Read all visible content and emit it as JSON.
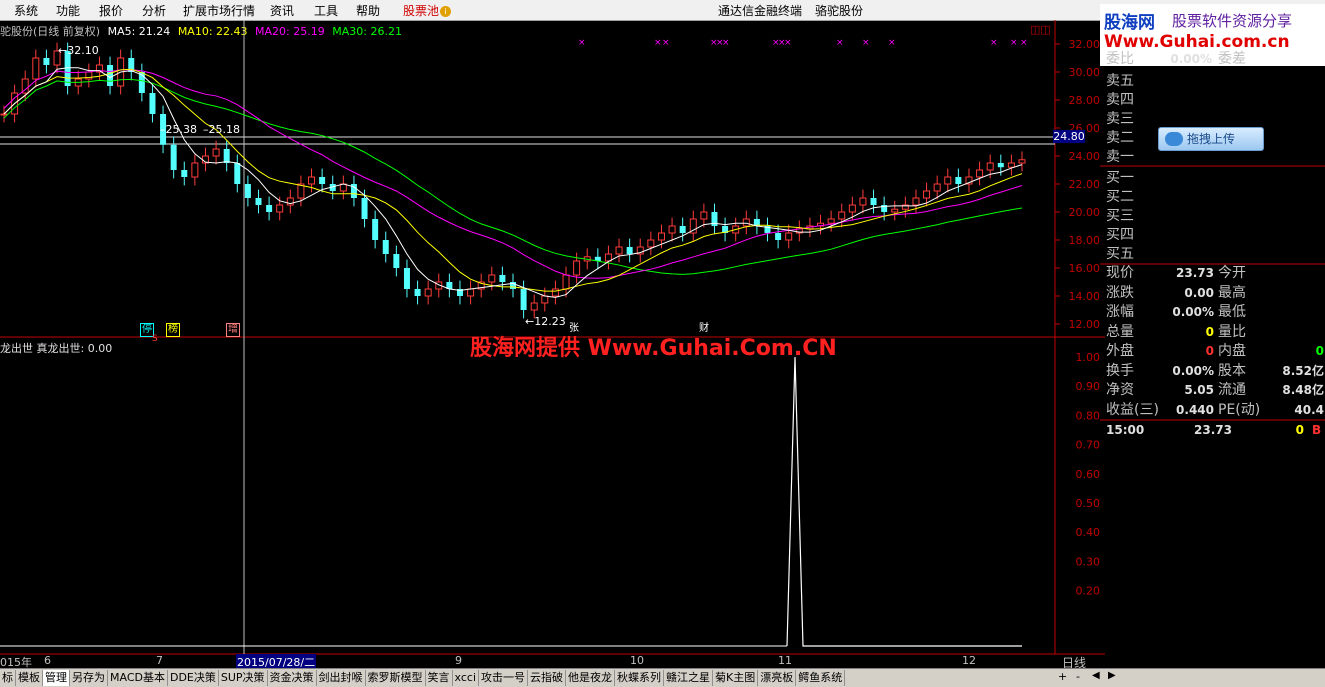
{
  "menu": {
    "items": [
      "系统",
      "功能",
      "报价",
      "分析",
      "扩展市场行情",
      "资讯",
      "工具",
      "帮助"
    ],
    "pool": "股票池",
    "center_title": "通达信金融终端",
    "stock_title": "骆驼股份"
  },
  "logo": {
    "line1": "股海网",
    "line1b": "股票软件资源分享",
    "line2": "Www.Guhai.com.cn"
  },
  "legend": {
    "title": "驼股份(日线 前复权)",
    "ma5": "MA5: 21.24",
    "ma10": "MA10: 22.43",
    "ma20": "MA20: 25.19",
    "ma30": "MA30: 26.21",
    "colors": {
      "ma5": "#ffffff",
      "ma10": "#ffff00",
      "ma20": "#ff00ff",
      "ma30": "#00ff00"
    }
  },
  "indicator_legend": "龙出世 真龙出世: 0.00",
  "watermark": "股海网提供 Www.Guhai.Com.CN",
  "price_tag": "24.80",
  "annotations": {
    "high": "32.10",
    "mid_left": "25.38",
    "mid_right": "25.18",
    "low": "12.23"
  },
  "markers": {
    "ting": "停",
    "bang": "榜",
    "zeng": "增",
    "zhang": "张",
    "cai": "财",
    "s": "S"
  },
  "price_axis": [
    "32.00",
    "30.00",
    "28.00",
    "26.00",
    "24.00",
    "22.00",
    "20.00",
    "18.00",
    "16.00",
    "14.00",
    "12.00"
  ],
  "ind_axis": [
    "1.00",
    "0.90",
    "0.80",
    "0.70",
    "0.60",
    "0.50",
    "0.40",
    "0.30",
    "0.20"
  ],
  "date_axis": {
    "labels": [
      "015年",
      "6",
      "7",
      "9",
      "10",
      "11",
      "12"
    ],
    "selected": "2015/07/28/二"
  },
  "period": "日线",
  "upload_button": "拖拽上传",
  "quote": {
    "asks": [
      "卖五",
      "卖四",
      "卖三",
      "卖二",
      "卖一"
    ],
    "bids": [
      "买一",
      "买二",
      "买三",
      "买四",
      "买五"
    ],
    "top_partial": {
      "label": "委比",
      "value": "0.00%",
      "label2": "委差"
    },
    "rows": [
      {
        "l1": "现价",
        "v1": "23.73",
        "l2": "今开",
        "v2": ""
      },
      {
        "l1": "涨跌",
        "v1": "0.00",
        "l2": "最高",
        "v2": ""
      },
      {
        "l1": "涨幅",
        "v1": "0.00%",
        "l2": "最低",
        "v2": ""
      },
      {
        "l1": "总量",
        "v1": "0",
        "l2": "量比",
        "v2": ""
      },
      {
        "l1": "外盘",
        "v1": "0",
        "l2": "内盘",
        "v2": "0"
      },
      {
        "l1": "换手",
        "v1": "0.00%",
        "l2": "股本",
        "v2": "8.52亿"
      },
      {
        "l1": "净资",
        "v1": "5.05",
        "l2": "流通",
        "v2": "8.48亿"
      },
      {
        "l1": "收益(三)",
        "v1": "0.440",
        "l2": "PE(动)",
        "v2": "40.4"
      }
    ],
    "tick": {
      "time": "15:00",
      "price": "23.73",
      "vol": "0",
      "side": "B"
    }
  },
  "tabs": [
    {
      "label": "标",
      "active": false
    },
    {
      "label": "模板",
      "active": false
    },
    {
      "label": "管理",
      "active": true
    },
    {
      "label": "另存为",
      "active": false
    },
    {
      "label": "MACD基本",
      "active": false
    },
    {
      "label": "DDE决策",
      "active": false
    },
    {
      "label": "SUP决策",
      "active": false
    },
    {
      "label": "资金决策",
      "active": false
    },
    {
      "label": "剑出封喉",
      "active": false
    },
    {
      "label": "索罗斯模型",
      "active": false
    },
    {
      "label": "笑言",
      "active": false
    },
    {
      "label": "xcci",
      "active": false
    },
    {
      "label": "攻击一号",
      "active": false
    },
    {
      "label": "云指破",
      "active": false
    },
    {
      "label": "他是夜龙",
      "active": false
    },
    {
      "label": "秋蝶系列",
      "active": false
    },
    {
      "label": "赣江之星",
      "active": false
    },
    {
      "label": "菊K主图",
      "active": false
    },
    {
      "label": "漂亮板",
      "active": false
    },
    {
      "label": "鳄鱼系统",
      "active": false
    }
  ],
  "tab_controls": [
    "+",
    "-",
    "◀",
    "▶"
  ]
}
